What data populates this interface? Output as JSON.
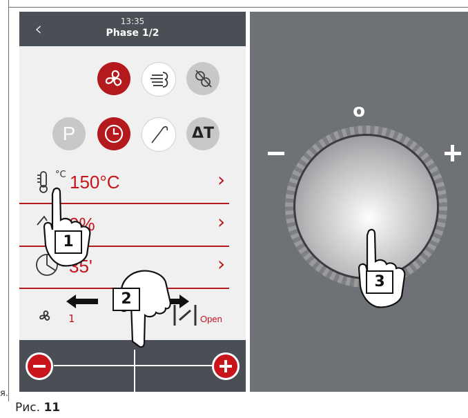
{
  "caption": {
    "prefix": "Рис.",
    "number": "11",
    "cutoff_text": "я."
  },
  "phone": {
    "time": "13:35",
    "phase": "Phase 1/2",
    "back_icon": "chevron-left",
    "modes_row1": [
      "fan-icon",
      "steam-icon",
      "no-fan-icon"
    ],
    "modes_row2": [
      "program-icon",
      "clock-icon",
      "probe-icon",
      "delta-t-icon"
    ],
    "program_letter": "P",
    "delta_t": "ΔT",
    "rows": [
      {
        "icon": "thermometer-icon",
        "unit": "°C",
        "value": "150°C"
      },
      {
        "icon": "humidity-icon",
        "value": "0%"
      },
      {
        "icon": "timer-icon",
        "value": "35'"
      }
    ],
    "fan_speed": "1",
    "damper_state": "Open",
    "accent_color": "#b3191d"
  },
  "knob": {
    "top_label": "o",
    "minus": "−",
    "plus": "+"
  },
  "callouts": [
    "1",
    "2",
    "3"
  ]
}
